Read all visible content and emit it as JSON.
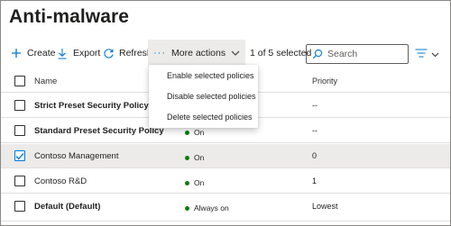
{
  "page": {
    "title": "Anti-malware"
  },
  "toolbar": {
    "create_label": "Create",
    "export_label": "Export",
    "refresh_label": "Refresh",
    "more_actions_label": "More actions",
    "selection_text": "1 of 5 selected",
    "search_placeholder": "Search",
    "search_value": ""
  },
  "more_actions_menu": {
    "items": [
      "Enable selected policies",
      "Disable selected policies",
      "Delete selected policies"
    ]
  },
  "table": {
    "columns": {
      "name": "Name",
      "status": "",
      "priority": "Priority"
    },
    "rows": [
      {
        "name": "Strict Preset Security Policy",
        "status": "",
        "priority": "--",
        "selected": false
      },
      {
        "name": "Standard Preset Security Policy",
        "status": "On",
        "priority": "--",
        "selected": false
      },
      {
        "name": "Contoso Management",
        "status": "On",
        "priority": "0",
        "selected": true
      },
      {
        "name": "Contoso R&D",
        "status": "On",
        "priority": "1",
        "selected": false
      },
      {
        "name": "Default (Default)",
        "status": "Always on",
        "priority": "Lowest",
        "selected": false
      }
    ]
  },
  "colors": {
    "accent": "#0078d4",
    "status_on": "#107c10",
    "selected_row": "#edebe9"
  },
  "icons": [
    "plus-icon",
    "download-icon",
    "refresh-icon",
    "more-dots-icon",
    "chevron-down-icon",
    "search-icon",
    "filter-lines-icon",
    "checkmark-icon"
  ]
}
